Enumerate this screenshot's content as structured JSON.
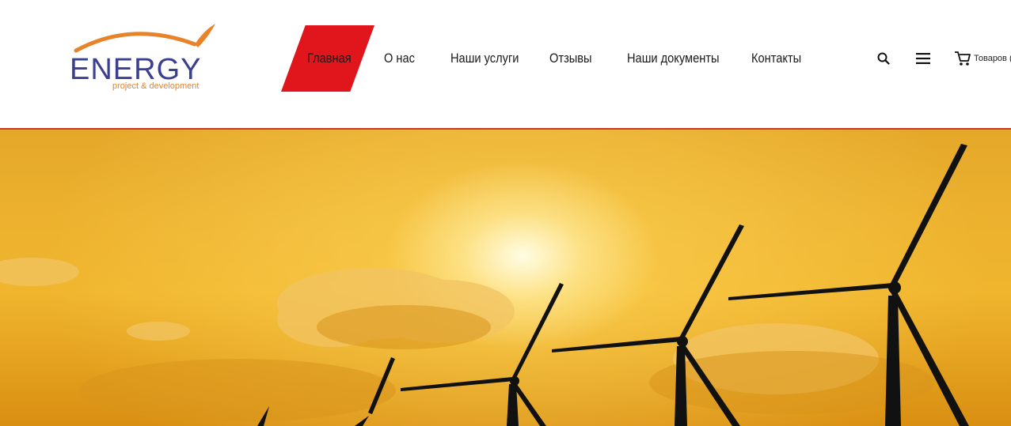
{
  "logo": {
    "title": "ENERGY",
    "subtitle": "project & development"
  },
  "nav": {
    "items": [
      {
        "label": "Главная",
        "active": true
      },
      {
        "label": "О нас"
      },
      {
        "label": "Наши услуги"
      },
      {
        "label": "Отзывы"
      },
      {
        "label": "Наши документы"
      },
      {
        "label": "Контакты"
      }
    ]
  },
  "header_icons": {
    "search": "search-icon",
    "menu": "hamburger-menu-icon",
    "cart": "cart-icon",
    "cart_label": "Товаров ("
  },
  "colors": {
    "accent": "#e0161c",
    "logo_blue": "#3a3f8f",
    "logo_orange": "#e8832a",
    "divider": "#c9372b"
  },
  "hero": {
    "image": "sunset wind turbines"
  }
}
